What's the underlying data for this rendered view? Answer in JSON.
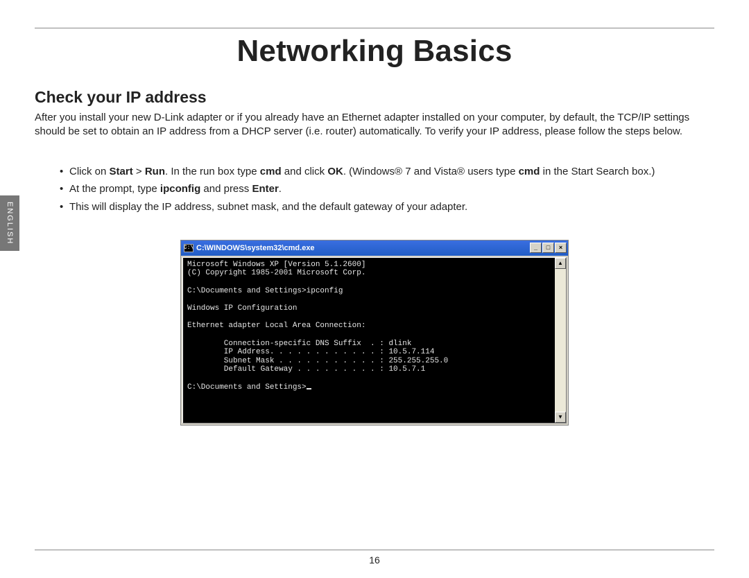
{
  "page": {
    "title": "Networking Basics",
    "section_heading": "Check your IP address",
    "intro": "After you install your new D-Link adapter or if you already have an Ethernet adapter installed on your computer, by default, the TCP/IP settings should be set to obtain an IP address from a DHCP server (i.e. router) automatically. To verify your IP address, please follow the steps below.",
    "page_number": "16",
    "language_tab": "ENGLISH"
  },
  "steps": {
    "s1": {
      "a": "Click on ",
      "b1": "Start",
      "c": " > ",
      "b2": "Run",
      "d": ". In the run box type ",
      "b3": "cmd",
      "e": " and click ",
      "b4": "OK",
      "f": ". (Windows® 7 and Vista® users type ",
      "b5": "cmd",
      "g": " in the Start Search box.)"
    },
    "s2": {
      "a": "At the prompt, type ",
      "b1": "ipconfig",
      "c": " and press ",
      "b2": "Enter",
      "d": "."
    },
    "s3": {
      "a": "This will display the IP address, subnet mask, and the default gateway of your adapter."
    }
  },
  "cmd": {
    "title": "C:\\WINDOWS\\system32\\cmd.exe",
    "icon_glyph": "C:\\",
    "btn_min": "_",
    "btn_max": "□",
    "btn_close": "×",
    "scroll_up": "▲",
    "scroll_down": "▼",
    "lines": {
      "l0": "Microsoft Windows XP [Version 5.1.2600]",
      "l1": "(C) Copyright 1985-2001 Microsoft Corp.",
      "l2": "",
      "l3": "C:\\Documents and Settings>ipconfig",
      "l4": "",
      "l5": "Windows IP Configuration",
      "l6": "",
      "l7": "Ethernet adapter Local Area Connection:",
      "l8": "",
      "l9": "        Connection-specific DNS Suffix  . : dlink",
      "l10": "        IP Address. . . . . . . . . . . . : 10.5.7.114",
      "l11": "        Subnet Mask . . . . . . . . . . . : 255.255.255.0",
      "l12": "        Default Gateway . . . . . . . . . : 10.5.7.1",
      "l13": "",
      "l14": "C:\\Documents and Settings>"
    }
  }
}
